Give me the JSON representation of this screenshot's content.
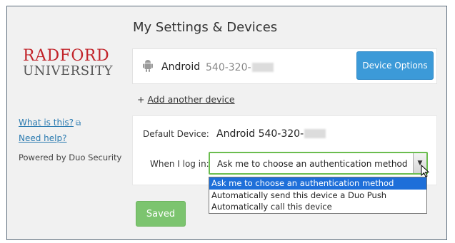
{
  "page": {
    "heading": "My Settings & Devices"
  },
  "logo": {
    "line1": "RADFORD",
    "line2": "UNIVERSITY"
  },
  "sidebar": {
    "what_is_this": "What is this?",
    "need_help": "Need help?",
    "powered_by": "Powered by Duo Security"
  },
  "device": {
    "icon": "android-icon",
    "name": "Android",
    "number": "540-320-",
    "options_button": "Device Options"
  },
  "add_device": {
    "prefix": "+",
    "label": "Add another device"
  },
  "settings": {
    "default_device_label": "Default Device:",
    "default_device_value": "Android 540-320-",
    "when_login_label": "When I log in:",
    "selected_option": "Ask me to choose an authentication method",
    "options": [
      "Ask me to choose an authentication method",
      "Automatically send this device a Duo Push",
      "Automatically call this device"
    ]
  },
  "saved_button": "Saved",
  "colors": {
    "primary_button": "#3c9ad8",
    "saved_button": "#7cc46f",
    "focus_border": "#6bbd4f",
    "selected_option": "#1e6fd9",
    "logo_red": "#c2242a"
  }
}
